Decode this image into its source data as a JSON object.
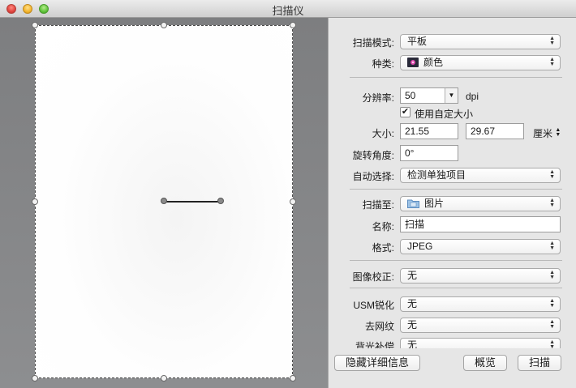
{
  "window": {
    "title": "扫描仪"
  },
  "settings": {
    "mode": {
      "label": "扫描模式:",
      "value": "平板"
    },
    "kind": {
      "label": "种类:",
      "value": "颜色"
    },
    "resolution": {
      "label": "分辨率:",
      "value": "50",
      "unit": "dpi"
    },
    "custom_size": {
      "label": "使用自定大小",
      "checked": true
    },
    "size": {
      "label": "大小:",
      "width": "21.55",
      "height": "29.67",
      "unit": "厘米"
    },
    "rotation": {
      "label": "旋转角度:",
      "value": "0°"
    },
    "auto_select": {
      "label": "自动选择:",
      "value": "检测单独项目"
    },
    "scan_to": {
      "label": "扫描至:",
      "value": "图片"
    },
    "name": {
      "label": "名称:",
      "value": "扫描"
    },
    "format": {
      "label": "格式:",
      "value": "JPEG"
    },
    "image_correction": {
      "label": "图像校正:",
      "value": "无"
    },
    "usm": {
      "label": "USM锐化",
      "value": "无"
    },
    "descreen": {
      "label": "去网纹",
      "value": "无"
    },
    "backlight": {
      "label": "背光补偿",
      "value": "无"
    }
  },
  "buttons": {
    "hide_details": "隐藏详细信息",
    "overview": "概览",
    "scan": "扫描"
  }
}
